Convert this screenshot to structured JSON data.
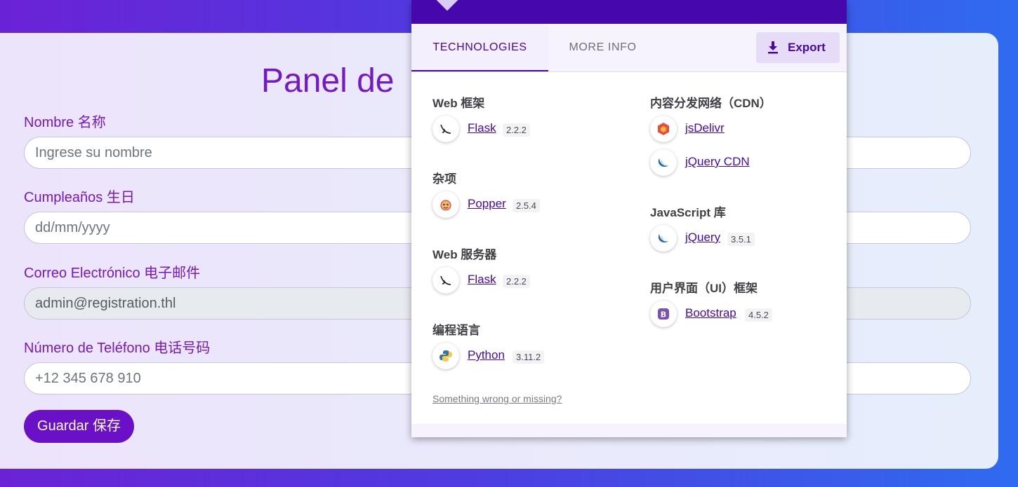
{
  "form": {
    "title": "Panel de",
    "fields": [
      {
        "label": "Nombre  名称",
        "placeholder": "Ingrese su nombre"
      },
      {
        "label": "Cumpleaños  生日",
        "placeholder": "dd/mm/yyyy"
      },
      {
        "label": "Correo Electrónico  电子邮件",
        "value": "admin@registration.thl"
      },
      {
        "label": "Número de Teléfono  电话号码",
        "placeholder": "+12 345 678 910"
      }
    ],
    "save_label": "Guardar  保存"
  },
  "popup": {
    "tabs": [
      "TECHNOLOGIES",
      "MORE INFO"
    ],
    "export_label": "Export",
    "left_column": [
      {
        "category": "Web 框架",
        "items": [
          {
            "name": "Flask",
            "version": "2.2.2",
            "icon": "flask-icon"
          }
        ]
      },
      {
        "category": "杂项",
        "items": [
          {
            "name": "Popper",
            "version": "2.5.4",
            "icon": "popper-icon"
          }
        ]
      },
      {
        "category": "Web 服务器",
        "items": [
          {
            "name": "Flask",
            "version": "2.2.2",
            "icon": "flask-icon"
          }
        ]
      },
      {
        "category": "编程语言",
        "items": [
          {
            "name": "Python",
            "version": "3.11.2",
            "icon": "python-icon"
          }
        ]
      }
    ],
    "right_column": [
      {
        "category": "内容分发网络（CDN）",
        "items": [
          {
            "name": "jsDelivr",
            "version": "",
            "icon": "jsdelivr-icon"
          },
          {
            "name": "jQuery CDN",
            "version": "",
            "icon": "jquery-icon"
          }
        ]
      },
      {
        "category": "JavaScript 库",
        "items": [
          {
            "name": "jQuery",
            "version": "3.5.1",
            "icon": "jquery-icon"
          }
        ]
      },
      {
        "category": "用户界面（UI）框架",
        "items": [
          {
            "name": "Bootstrap",
            "version": "4.5.2",
            "icon": "bootstrap-icon"
          }
        ]
      }
    ],
    "missing_link": "Something wrong or missing?"
  },
  "colors": {
    "accent": "#7419c6",
    "popup_header": "#4608ad",
    "save_button": "#6a11c8"
  }
}
